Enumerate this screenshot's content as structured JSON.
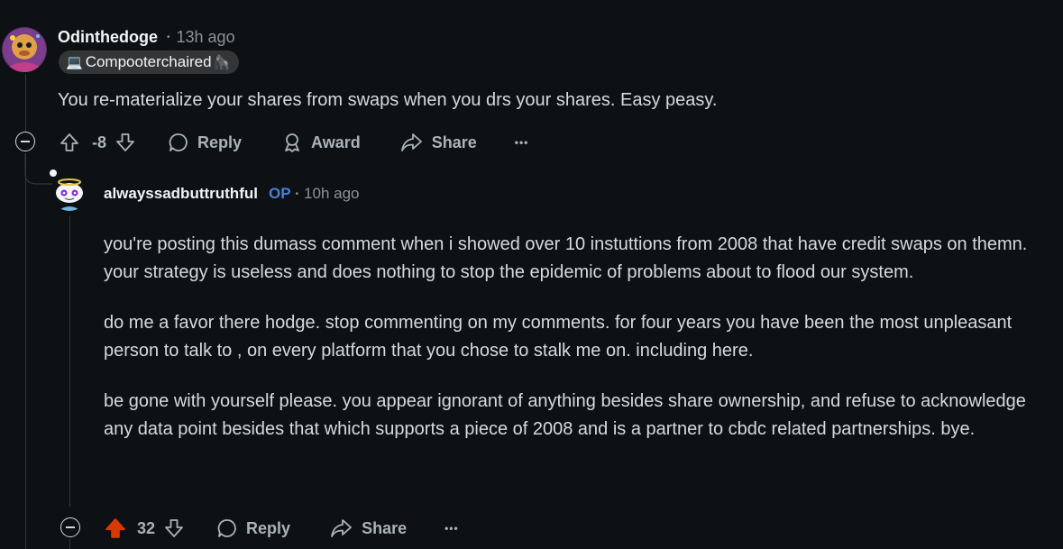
{
  "parent_comment": {
    "username": "Odinthedoge",
    "time": "13h ago",
    "flair": "Compooterchaired",
    "body": "You re-materialize your shares from swaps when you drs your shares. Easy peasy.",
    "score": "-8",
    "actions": {
      "reply": "Reply",
      "award": "Award",
      "share": "Share",
      "more": "•••"
    }
  },
  "reply_comment": {
    "username": "alwayssadbuttruthful",
    "op_tag": "OP",
    "time": "10h ago",
    "paragraphs": [
      "you're posting this dumass comment when i showed over 10 instuttions from 2008 that have credit swaps on themn. your strategy is useless and does nothing to stop the epidemic of problems about to flood our system.",
      "do me a favor there hodge. stop commenting on my comments. for four years you have been the most unpleasant person to talk to , on every platform that you chose to stalk me on. including here.",
      "be gone with yourself please. you appear ignorant of anything besides share ownership, and refuse to acknowledge any data point besides that which supports a piece of 2008 and is a partner to cbdc related partnerships. bye."
    ],
    "score": "32",
    "actions": {
      "reply": "Reply",
      "share": "Share",
      "more": "•••"
    }
  },
  "colors": {
    "background": "#0e1113",
    "upvoted": "#d93900",
    "op": "#4a7fd6",
    "muted": "#8a9397"
  }
}
